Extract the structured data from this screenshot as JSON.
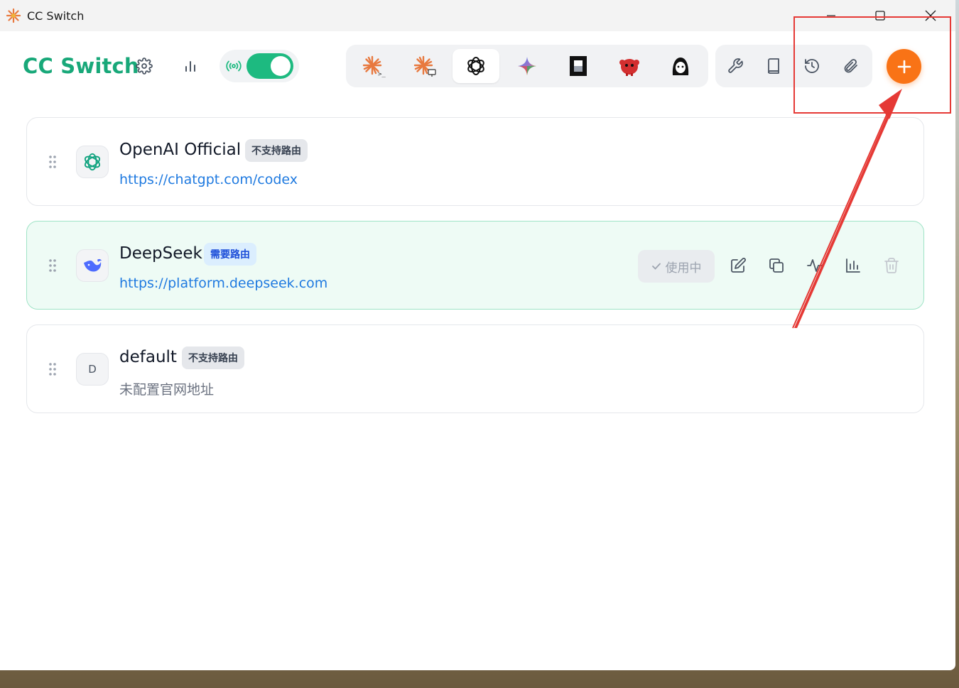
{
  "window": {
    "title": "CC Switch",
    "controls": [
      "minimize",
      "maximize",
      "close"
    ]
  },
  "header": {
    "brand": "CC Switch",
    "proxy_toggle_on": true,
    "app_tabs": [
      {
        "name": "claude-code",
        "active": false
      },
      {
        "name": "claude-desktop",
        "active": false
      },
      {
        "name": "codex",
        "active": true
      },
      {
        "name": "gemini",
        "active": false
      },
      {
        "name": "opencode",
        "active": false
      },
      {
        "name": "red-mascot",
        "active": false
      },
      {
        "name": "character-avatar",
        "active": false
      }
    ],
    "tools": [
      "wrench-icon",
      "book-icon",
      "history-icon",
      "paperclip-icon"
    ],
    "add_button": "+"
  },
  "providers": [
    {
      "name": "OpenAI Official",
      "badge": "不支持路由",
      "url": "https://chatgpt.com/codex",
      "icon_letter": "",
      "active": false
    },
    {
      "name": "DeepSeek",
      "badge": "需要路由",
      "url": "https://platform.deepseek.com",
      "icon_letter": "",
      "active": true,
      "status_label": "使用中"
    },
    {
      "name": "default",
      "badge": "不支持路由",
      "url": "未配置官网地址",
      "icon_letter": "D",
      "active": false
    }
  ],
  "colors": {
    "brand": "#18a879",
    "toggle": "#1dba80",
    "add_button": "#f97316",
    "link": "#1f7ae0",
    "annotation": "#e53935"
  }
}
